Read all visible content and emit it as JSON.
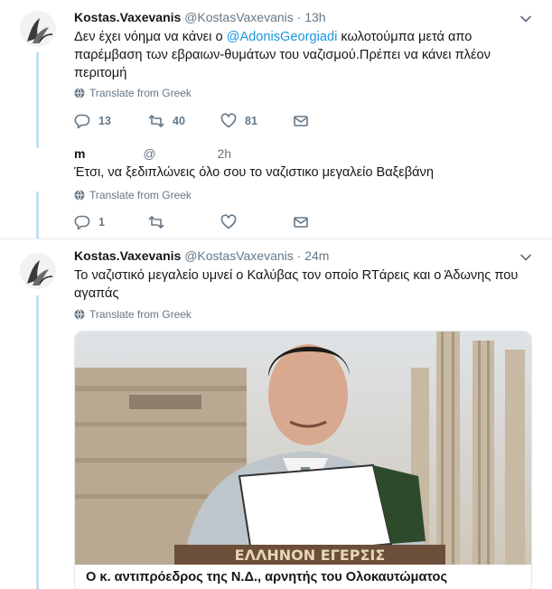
{
  "tweets": [
    {
      "author_name": "Kostas.Vaxevanis",
      "handle": "@KostasVaxevanis",
      "separator": "·",
      "time": "13h",
      "text_before": "Δεν έχει νόημα να κάνει ο ",
      "mention": "@AdonisGeorgiadi",
      "text_after": " κωλοτούμπα μετά απο παρέμβαση των εβραιων-θυμάτων του ναζισμού.Πρέπει να κάνει πλέον περιτομή",
      "translate_label": "Translate from Greek",
      "reply_count": "13",
      "retweet_count": "40",
      "like_count": "81"
    },
    {
      "author_name": "m",
      "handle": "@",
      "time": "2h",
      "text": "Έτσι, να ξεδιπλώνεις όλο σου το ναζιστικο μεγαλείο Βαξεβάνη",
      "translate_label": "Translate from Greek",
      "reply_count": "1"
    },
    {
      "author_name": "Kostas.Vaxevanis",
      "handle": "@KostasVaxevanis",
      "separator": "·",
      "time": "24m",
      "text": "Το ναζιστικό μεγαλείο υμνεί ο Καλύβας τον οποίο RTάρεις και ο Άδωνης που αγαπάς",
      "translate_label": "Translate from Greek",
      "card": {
        "banner_text": "ΕΛΛΗΝΟΝ ΕΓΕΡΣΙΣ",
        "title": "Ο κ. αντιπρόεδρος της Ν.Δ., αρνητής του Ολοκαυτώματος"
      }
    }
  ],
  "icons": {
    "reply": "reply-icon",
    "retweet": "retweet-icon",
    "like": "heart-icon",
    "dm": "envelope-icon",
    "more": "chevron-down-icon",
    "globe": "globe-icon"
  },
  "colors": {
    "link": "#1b95e0",
    "secondary": "#657786",
    "thread": "#c4dff2",
    "border": "#e6ecf0"
  }
}
